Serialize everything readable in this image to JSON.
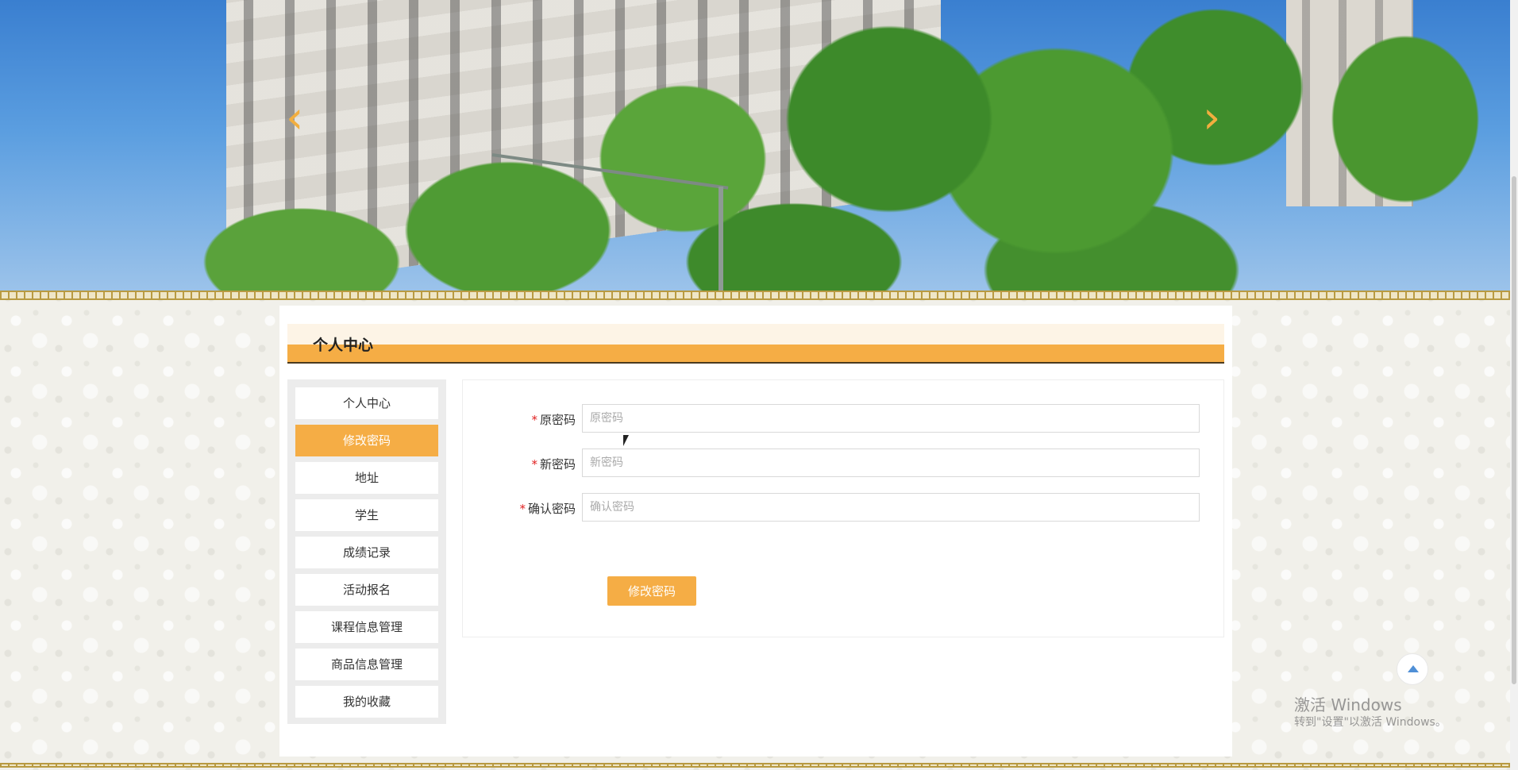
{
  "banner": {
    "prev_arrow": "‹",
    "next_arrow": "›"
  },
  "page": {
    "title": "个人中心"
  },
  "sidebar": {
    "items": [
      {
        "label": "个人中心",
        "active": false
      },
      {
        "label": "修改密码",
        "active": true
      },
      {
        "label": "地址",
        "active": false
      },
      {
        "label": "学生",
        "active": false
      },
      {
        "label": "成绩记录",
        "active": false
      },
      {
        "label": "活动报名",
        "active": false
      },
      {
        "label": "课程信息管理",
        "active": false
      },
      {
        "label": "商品信息管理",
        "active": false
      },
      {
        "label": "我的收藏",
        "active": false
      }
    ]
  },
  "form": {
    "fields": [
      {
        "required": "*",
        "label": "原密码",
        "placeholder": "原密码",
        "value": ""
      },
      {
        "required": "*",
        "label": "新密码",
        "placeholder": "新密码",
        "value": ""
      },
      {
        "required": "*",
        "label": "确认密码",
        "placeholder": "确认密码",
        "value": ""
      }
    ],
    "submit_label": "修改密码"
  },
  "back_to_top": {
    "icon": "arrow-up-icon"
  },
  "watermark": {
    "line1": "激活 Windows",
    "line2": "转到\"设置\"以激活 Windows。"
  },
  "colors": {
    "accent": "#f5ad45",
    "required": "#e02020",
    "title_bg": "#fdf4e6"
  }
}
